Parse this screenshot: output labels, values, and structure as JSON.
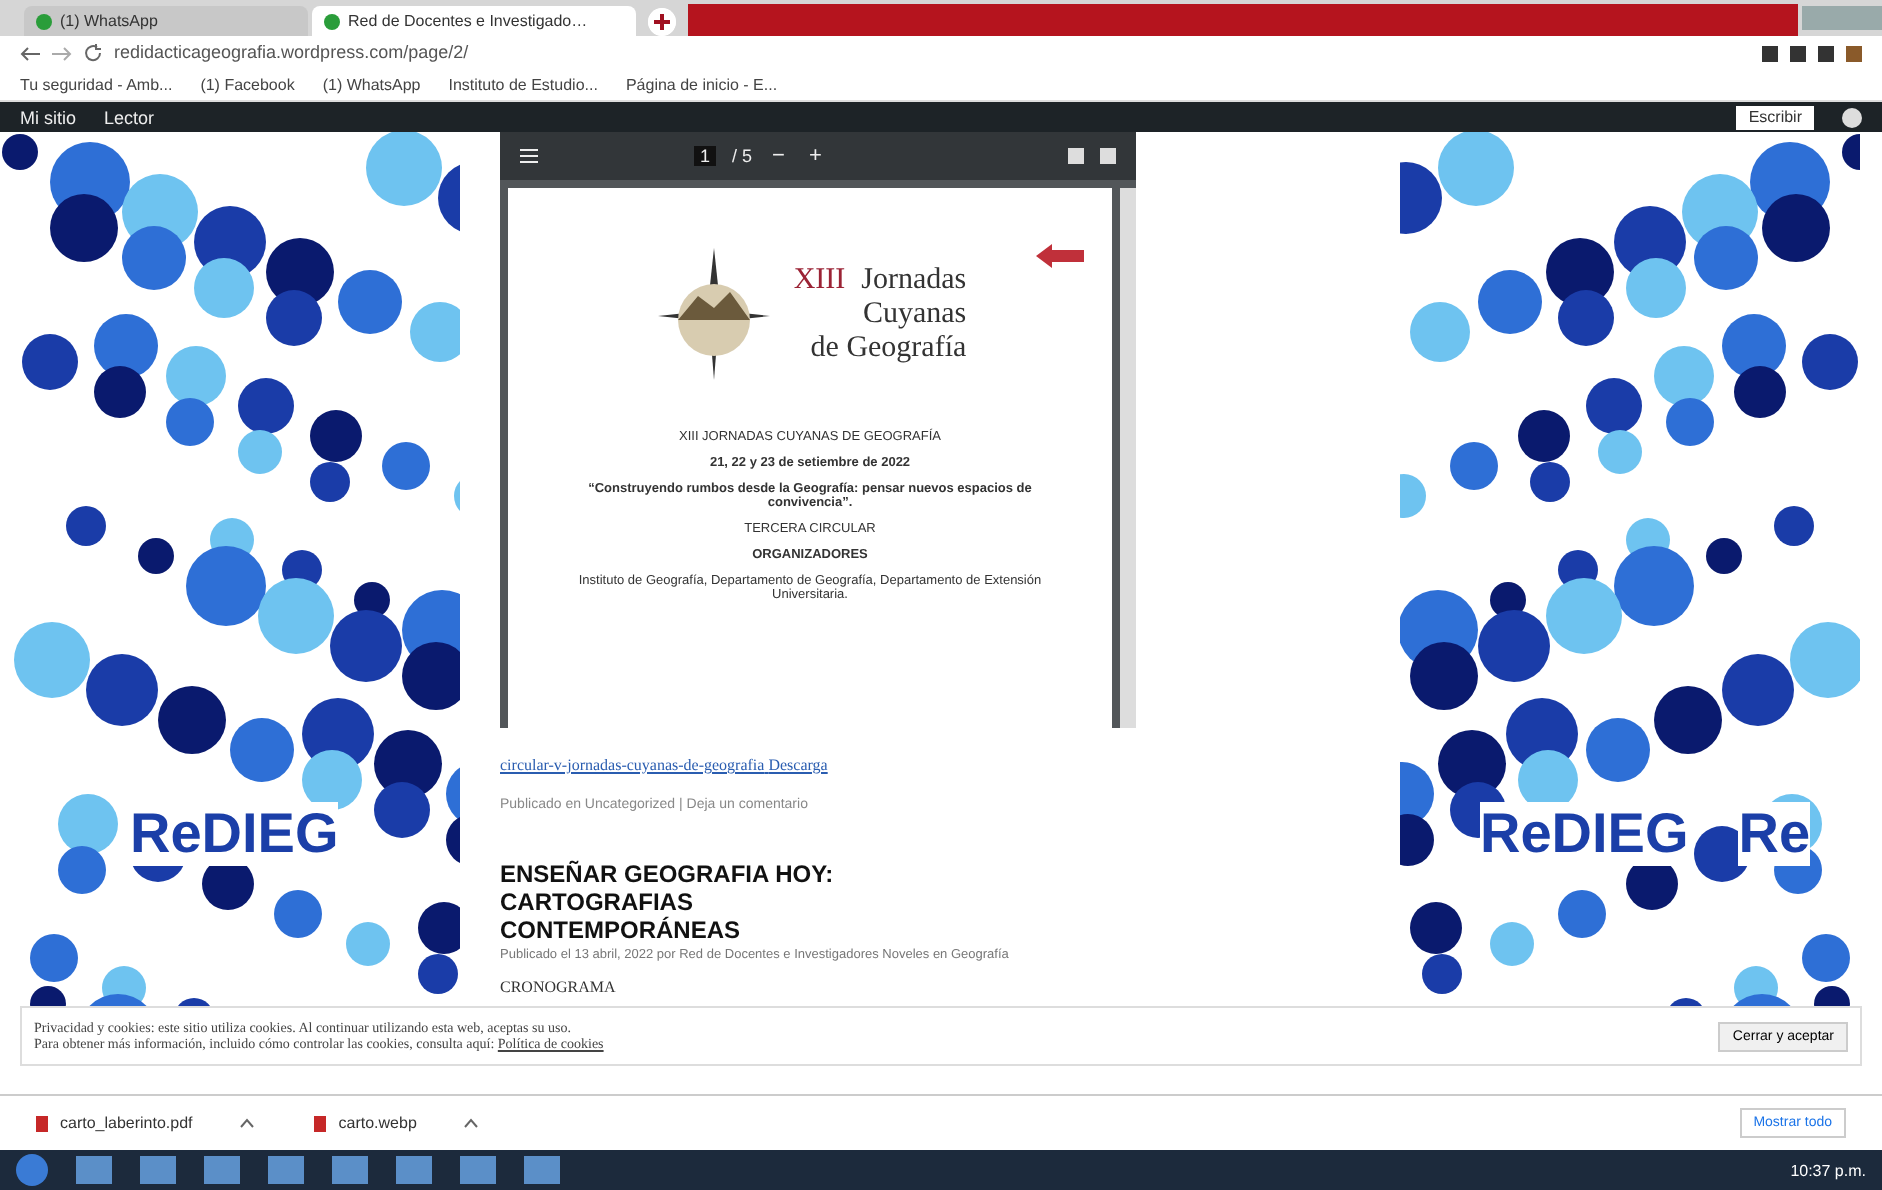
{
  "tabs": [
    {
      "title": "(1) WhatsApp",
      "selected": false
    },
    {
      "title": "Red de Docentes e Investigado…",
      "selected": true
    }
  ],
  "address": "redidacticageografia.wordpress.com/page/2/",
  "bookmarks": [
    "Tu seguridad - Amb...",
    "(1) Facebook",
    "(1) WhatsApp",
    "Instituto de Estudio...",
    "Página de inicio - E..."
  ],
  "admin_bar": {
    "site": "Mi sitio",
    "reader": "Lector",
    "write": "Escribir"
  },
  "pdf_viewer": {
    "page": "1",
    "page_count": "/ 5",
    "minus": "−",
    "plus": "+",
    "logo": {
      "numeral": "XIII",
      "line_1": "Jornadas",
      "line_2": "Cuyanas",
      "line_3": "de Geografía"
    },
    "lines": [
      {
        "text": "XIII JORNADAS CUYANAS DE GEOGRAFÍA",
        "bold": false
      },
      {
        "text": "21, 22 y 23 de setiembre de 2022",
        "bold": true
      },
      {
        "text": "“Construyendo rumbos desde la Geografía: pensar nuevos espacios de convivencia”.",
        "bold": true
      },
      {
        "text": "TERCERA CIRCULAR",
        "bold": false
      },
      {
        "text": "ORGANIZADORES",
        "bold": true
      },
      {
        "text": "Instituto de Geografía, Departamento de Geografía, Departamento de Extensión Universitaria.",
        "bold": false
      }
    ]
  },
  "download_link": "circular-v-jornadas-cuyanas-de-geografia",
  "download_button": "Descarga",
  "post_meta": "Publicado en Uncategorized | Deja un comentario",
  "post": {
    "title": "ENSEÑAR GEOGRAFIA HOY: CARTOGRAFIAS CONTEMPORÁNEAS",
    "byline": "Publicado el 13 abril, 2022 por Red de Docentes e Investigadores Noveles en Geografía",
    "body": "CRONOGRAMA"
  },
  "logos": [
    "ReDIEG",
    "ReDIEG",
    "Re"
  ],
  "cookie_banner": {
    "line_1": "Privacidad y cookies: este sitio utiliza cookies. Al continuar utilizando esta web, aceptas su uso.",
    "line_2": "Para obtener más información, incluido cómo controlar las cookies, consulta aquí:",
    "link": "Política de cookies",
    "button": "Cerrar y aceptar"
  },
  "downloads": [
    "carto_laberinto.pdf",
    "carto.webp"
  ],
  "show_all": "Mostrar todo",
  "clock": "10:37 p.m."
}
